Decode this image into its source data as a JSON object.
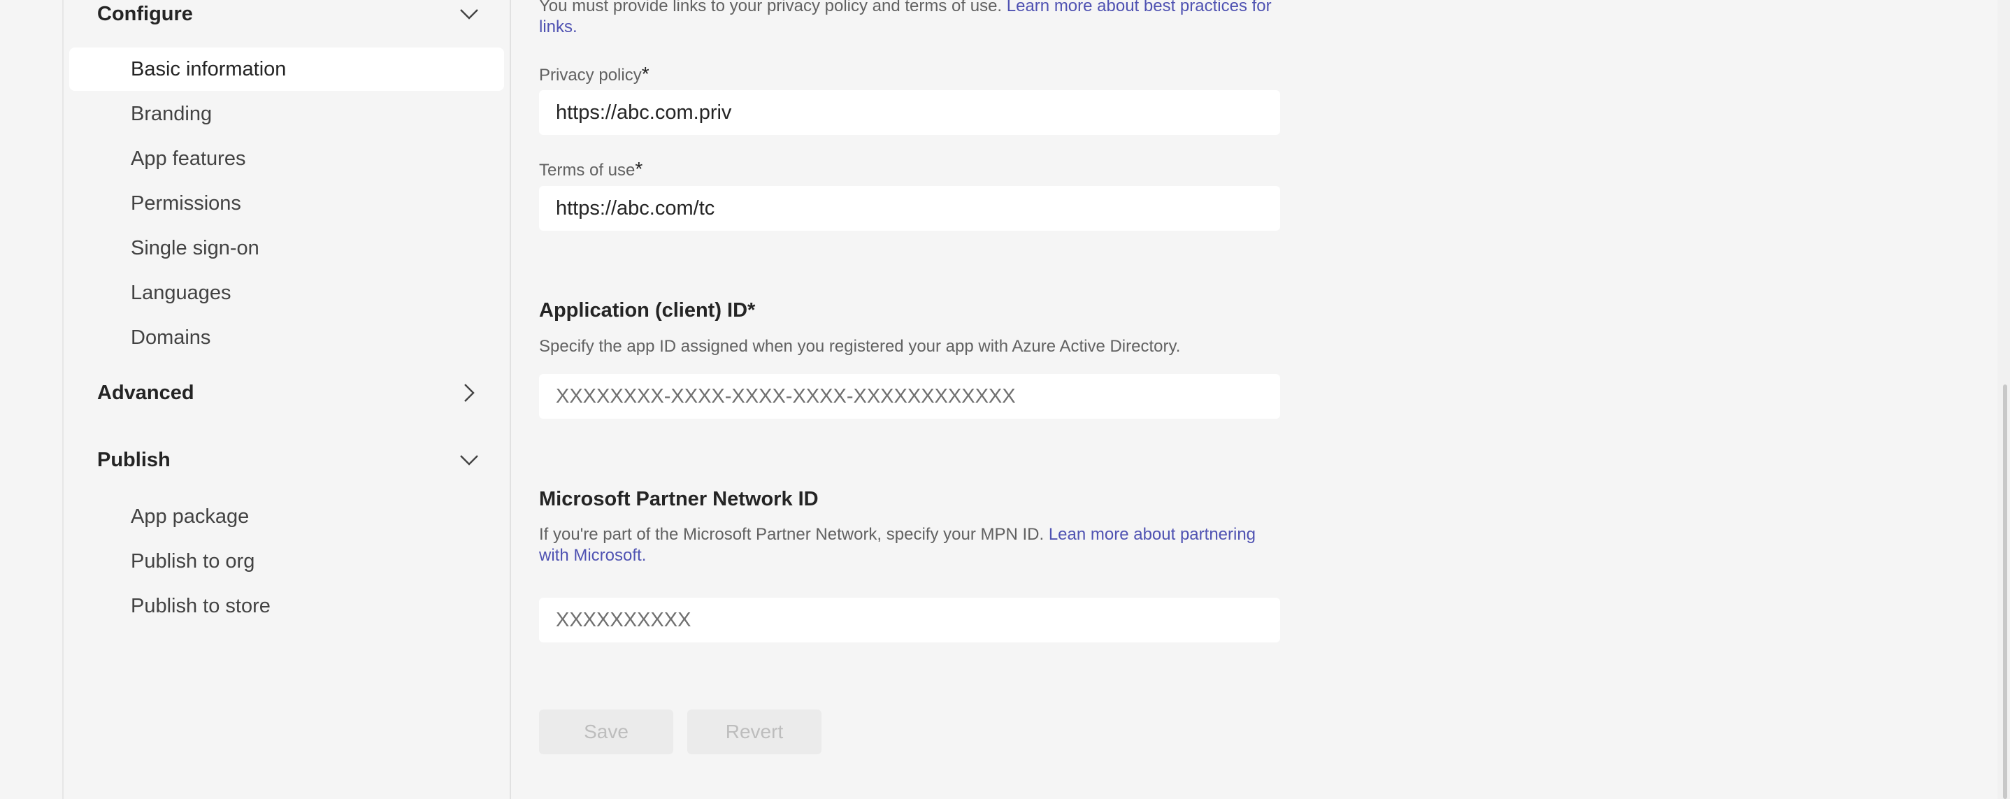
{
  "sidebar": {
    "configure": {
      "label": "Configure",
      "icon": "chevron-down-icon",
      "items": [
        {
          "label": "Basic information",
          "selected": true
        },
        {
          "label": "Branding"
        },
        {
          "label": "App features"
        },
        {
          "label": "Permissions"
        },
        {
          "label": "Single sign-on"
        },
        {
          "label": "Languages"
        },
        {
          "label": "Domains"
        }
      ]
    },
    "advanced": {
      "label": "Advanced",
      "icon": "chevron-right-icon"
    },
    "publish": {
      "label": "Publish",
      "icon": "chevron-down-icon",
      "items": [
        {
          "label": "App package"
        },
        {
          "label": "Publish to org"
        },
        {
          "label": "Publish to store"
        }
      ]
    }
  },
  "main": {
    "links_intro": {
      "text": "You must provide links to your privacy policy and terms of use.",
      "link_text": "Learn more about best practices for links."
    },
    "privacy_policy": {
      "label": "Privacy policy",
      "required_mark": "*",
      "value": "https://abc.com.priv"
    },
    "terms_of_use": {
      "label": "Terms of use",
      "required_mark": "*",
      "value": "https://abc.com/tc"
    },
    "app_id": {
      "heading": "Application (client) ID*",
      "description": "Specify the app ID assigned when you registered your app with Azure Active Directory.",
      "placeholder": "XXXXXXXX-XXXX-XXXX-XXXX-XXXXXXXXXXXX"
    },
    "mpn": {
      "heading": "Microsoft Partner Network ID",
      "description": "If you're part of the Microsoft Partner Network, specify your MPN ID.",
      "link_text": "Lean more about partnering with Microsoft.",
      "placeholder": "XXXXXXXXXX"
    },
    "actions": {
      "save_label": "Save",
      "revert_label": "Revert"
    }
  },
  "colors": {
    "background": "#f5f5f5",
    "link": "#4f52b2",
    "selected_item": "#ffffff",
    "disabled_button": "#ebebeb"
  }
}
